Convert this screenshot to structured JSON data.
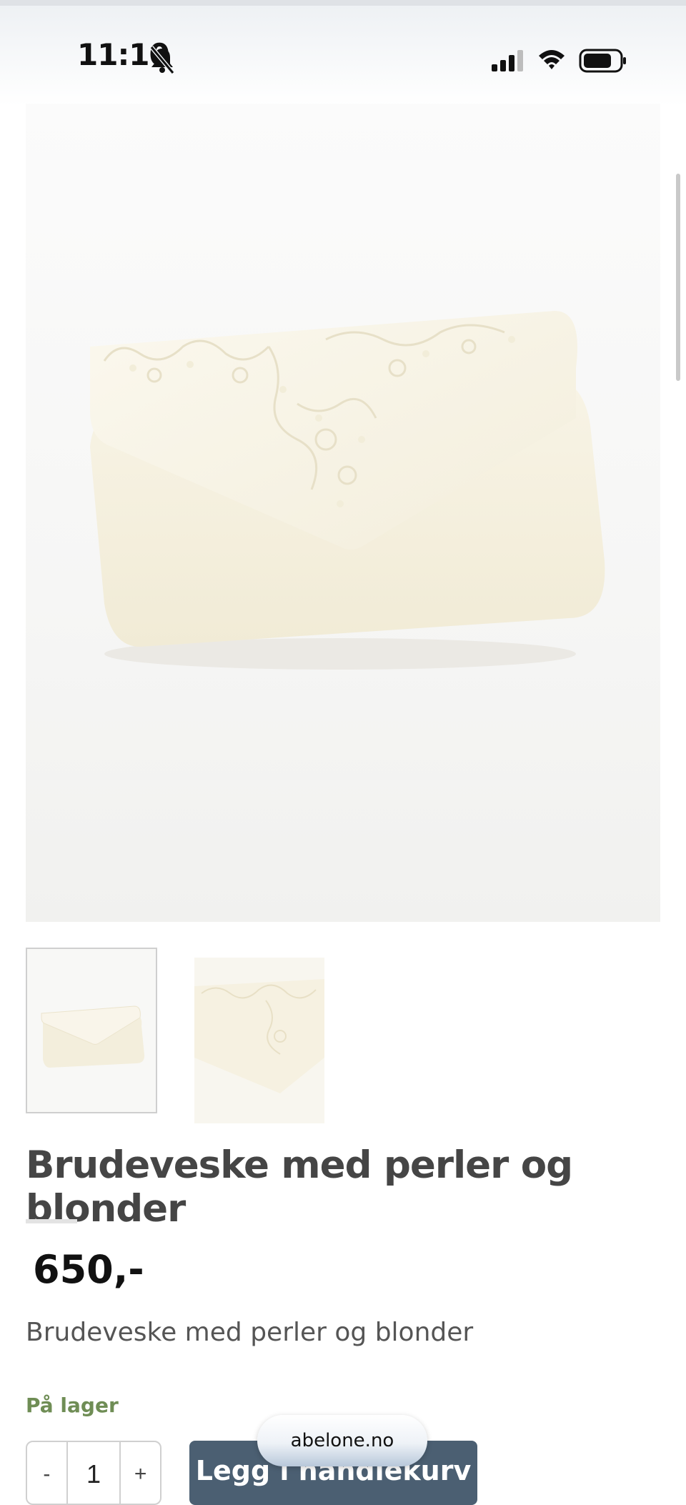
{
  "status": {
    "time": "11:10"
  },
  "product": {
    "title": "Brudeveske med perler og blonder",
    "price": "650,-",
    "short_description": "Brudeveske med perler og blonder",
    "stock": "På lager"
  },
  "quantity": {
    "minus": "-",
    "value": "1",
    "plus": "+"
  },
  "cart": {
    "add_label": "Legg i handlekurv"
  },
  "browser": {
    "url": "abelone.no"
  },
  "colors": {
    "accent_button": "#4b5f72",
    "stock_green": "#6f8d55"
  }
}
